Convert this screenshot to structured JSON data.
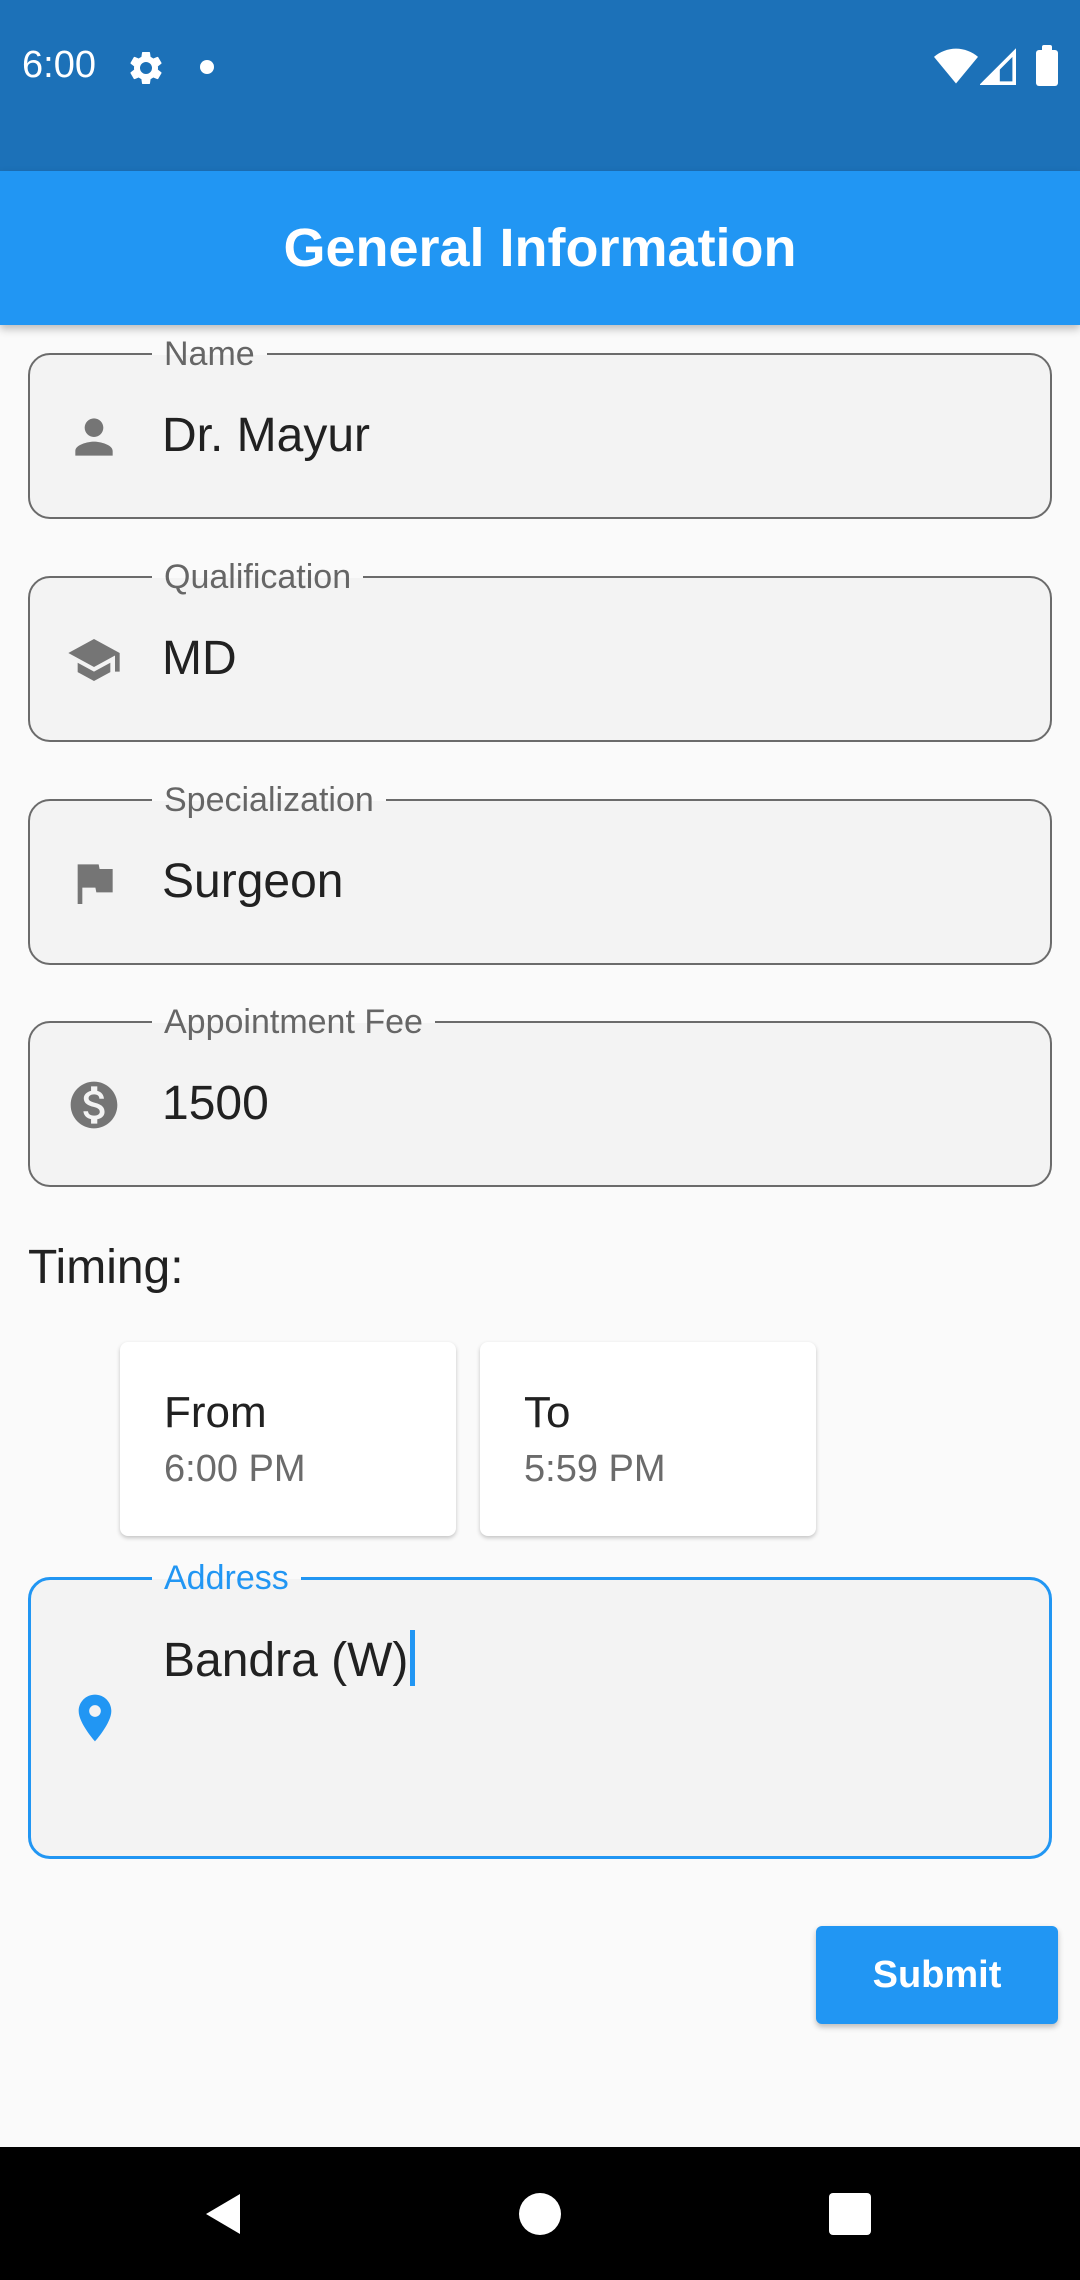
{
  "status_bar": {
    "time": "6:00",
    "icons": [
      "gear-icon",
      "notification-dot",
      "wifi-icon",
      "signal-icon",
      "battery-icon"
    ]
  },
  "app_bar": {
    "title": "General Information"
  },
  "form": {
    "name": {
      "label": "Name",
      "value": "Dr. Mayur",
      "icon": "person-icon"
    },
    "qualification": {
      "label": "Qualification",
      "value": "MD",
      "icon": "school-icon"
    },
    "specialization": {
      "label": "Specialization",
      "value": "Surgeon",
      "icon": "flag-icon"
    },
    "fee": {
      "label": "Appointment Fee",
      "value": "1500",
      "icon": "dollar-icon"
    },
    "timing": {
      "label": "Timing:",
      "from": {
        "title": "From",
        "value": "6:00 PM"
      },
      "to": {
        "title": "To",
        "value": "5:59 PM"
      }
    },
    "address": {
      "label": "Address",
      "value": "Bandra (W)",
      "icon": "location-pin-icon"
    },
    "submit_label": "Submit"
  },
  "colors": {
    "status_bar": "#1c71b8",
    "app_bar": "#2196f3",
    "accent": "#2196f3",
    "icon_gray": "#757575"
  },
  "nav_bar": {
    "icons": [
      "back-icon",
      "home-icon",
      "recents-icon"
    ]
  }
}
